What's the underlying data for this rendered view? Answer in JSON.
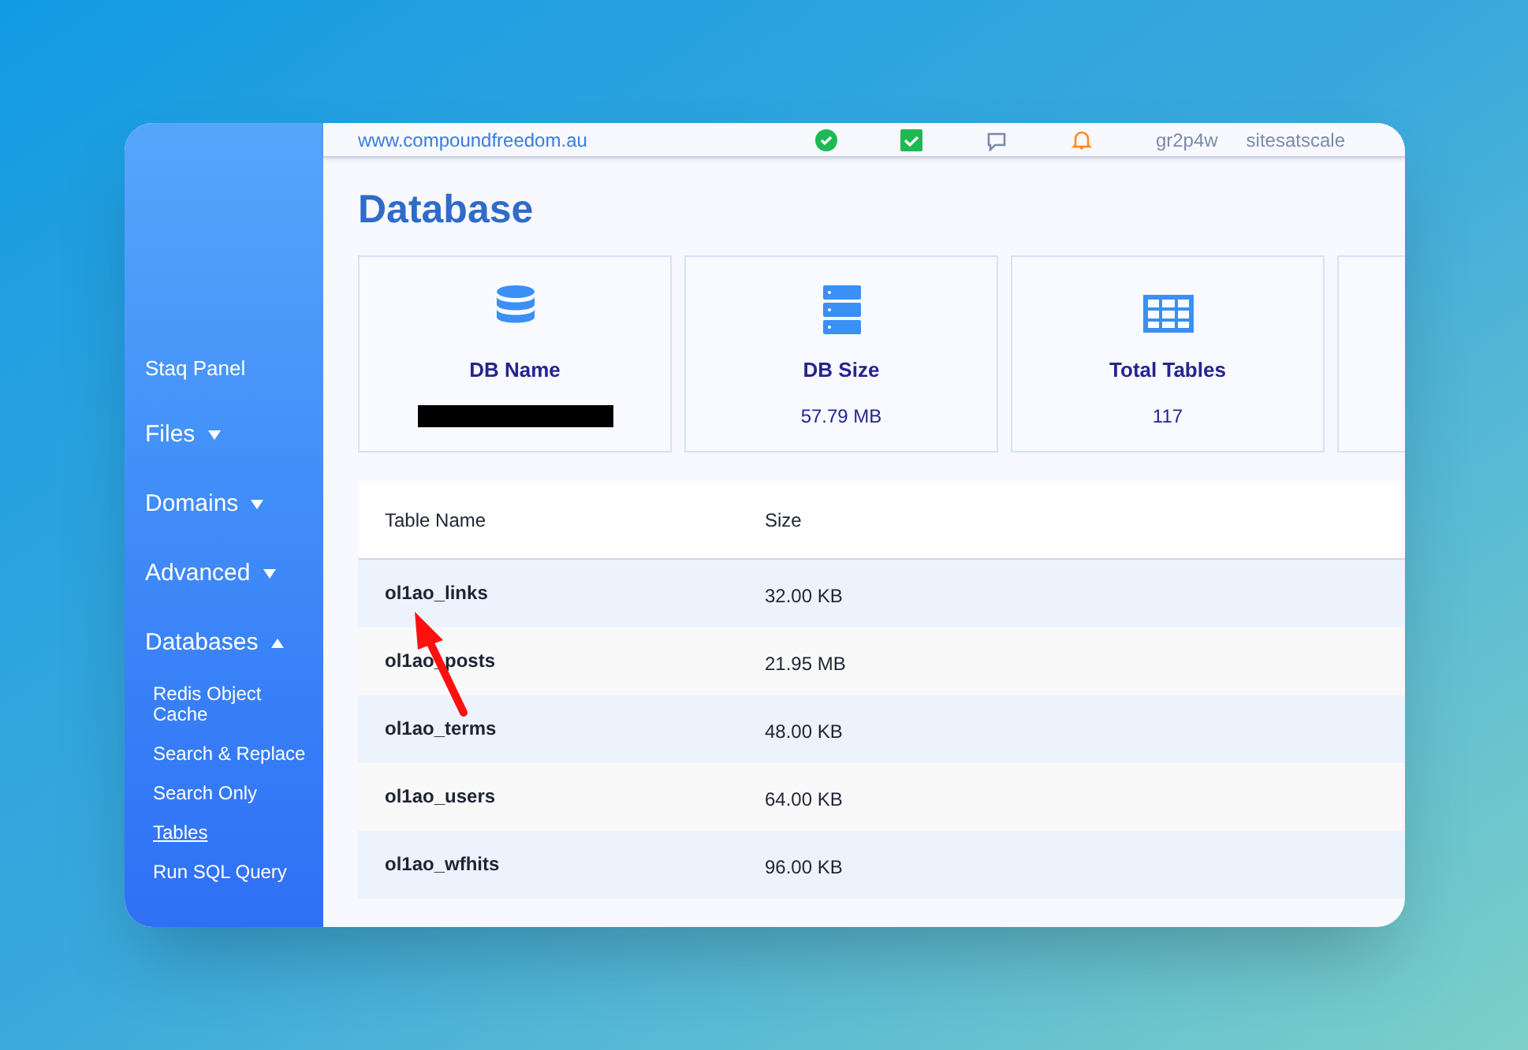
{
  "topbar": {
    "site_link": "www.compoundfreedom.au",
    "user": "gr2p4w",
    "account": "sitesatscale"
  },
  "sidebar": {
    "items": [
      {
        "label": "Staq Panel",
        "kind": "link"
      },
      {
        "label": "Files",
        "kind": "menu",
        "expanded": false
      },
      {
        "label": "Domains",
        "kind": "menu",
        "expanded": false
      },
      {
        "label": "Advanced",
        "kind": "menu",
        "expanded": false
      },
      {
        "label": "Databases",
        "kind": "menu",
        "expanded": true,
        "children": [
          {
            "label": "Redis Object Cache",
            "selected": false
          },
          {
            "label": "Search & Replace",
            "selected": false
          },
          {
            "label": "Search Only",
            "selected": false
          },
          {
            "label": "Tables",
            "selected": true
          },
          {
            "label": "Run SQL Query",
            "selected": false
          }
        ]
      }
    ]
  },
  "page_title": "Database",
  "stats": [
    {
      "kind": "database",
      "label": "DB Name",
      "redacted": true
    },
    {
      "kind": "server",
      "label": "DB Size",
      "value": "57.79 MB"
    },
    {
      "kind": "table",
      "label": "Total Tables",
      "value": "117"
    },
    {
      "kind": "partial"
    }
  ],
  "table": {
    "columns": [
      "Table Name",
      "Size"
    ],
    "rows": [
      [
        "ol1ao_links",
        "32.00 KB"
      ],
      [
        "ol1ao_posts",
        "21.95 MB"
      ],
      [
        "ol1ao_terms",
        "48.00 KB"
      ],
      [
        "ol1ao_users",
        "64.00 KB"
      ],
      [
        "ol1ao_wfhits",
        "96.00 KB"
      ]
    ]
  }
}
